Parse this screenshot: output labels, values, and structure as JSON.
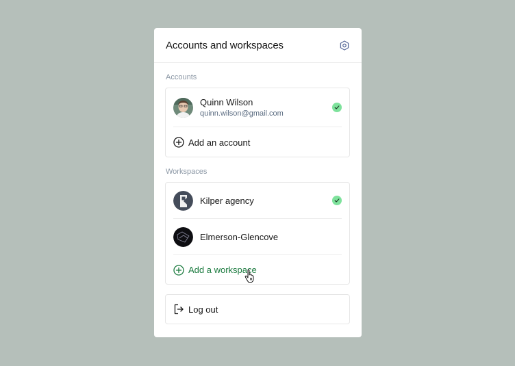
{
  "panel": {
    "title": "Accounts and workspaces"
  },
  "accounts": {
    "section_label": "Accounts",
    "items": [
      {
        "name": "Quinn Wilson",
        "email": "quinn.wilson@gmail.com",
        "selected": true
      }
    ],
    "add_label": "Add an account"
  },
  "workspaces": {
    "section_label": "Workspaces",
    "items": [
      {
        "name": "Kilper agency",
        "selected": true,
        "icon": "kilper-logo-icon"
      },
      {
        "name": "Elmerson-Glencove",
        "selected": false,
        "icon": "elmerson-logo-icon"
      }
    ],
    "add_label": "Add a workspace"
  },
  "logout": {
    "label": "Log out"
  },
  "colors": {
    "background": "#b5bfba",
    "check": "#7ee29c",
    "accent_green": "#1a7a3e",
    "email": "#5a6b80"
  }
}
